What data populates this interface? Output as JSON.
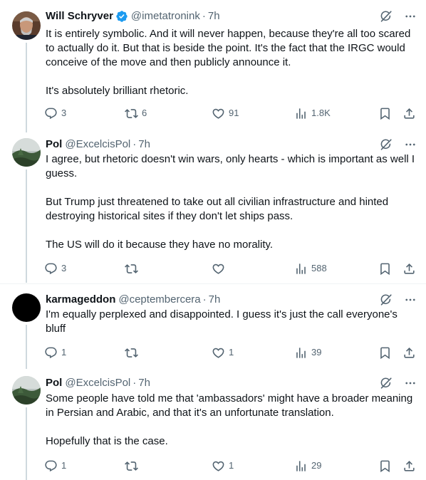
{
  "colors": {
    "text": "#0f1419",
    "muted": "#536471",
    "verified": "#1d9bf0",
    "thread_line": "#cfd9de",
    "divider": "#eff3f4"
  },
  "tweets": [
    {
      "name": "Will Schryver",
      "verified": true,
      "handle": "@imetatronink",
      "time": "7h",
      "paragraphs": [
        "It is entirely symbolic. And it will never happen, because they're all too scared to actually do it. But that is beside the point. It's the fact that the IRGC would conceive of the move and then publicly announce it.",
        "It's absolutely brilliant rhetoric."
      ],
      "replies": "3",
      "reposts": "6",
      "likes": "91",
      "views": "1.8K"
    },
    {
      "name": "Pol",
      "verified": false,
      "handle": "@ExcelcisPol",
      "time": "7h",
      "paragraphs": [
        "I agree, but rhetoric doesn't win wars, only hearts - which is important as well I guess.",
        "But Trump just threatened to take out all civilian infrastructure and hinted destroying historical sites if they don't let ships pass.",
        "The US will do it because they have no morality."
      ],
      "replies": "3",
      "reposts": "",
      "likes": "",
      "views": "588"
    },
    {
      "name": "karmageddon",
      "verified": false,
      "handle": "@ceptembercera",
      "time": "7h",
      "paragraphs": [
        "I'm equally perplexed and disappointed. I guess it's just the call everyone's bluff"
      ],
      "replies": "1",
      "reposts": "",
      "likes": "1",
      "views": "39"
    },
    {
      "name": "Pol",
      "verified": false,
      "handle": "@ExcelcisPol",
      "time": "7h",
      "paragraphs": [
        "Some people have told me that 'ambassadors' might have a broader meaning in Persian and Arabic, and that it's an unfortunate translation.",
        "Hopefully that is the case."
      ],
      "replies": "1",
      "reposts": "",
      "likes": "1",
      "views": "29"
    }
  ],
  "separator": "·",
  "icons": {
    "verified": "verified-badge-icon",
    "grok": "grok-icon",
    "more": "more-options-icon",
    "reply": "reply-icon",
    "repost": "repost-icon",
    "like": "like-icon",
    "views": "views-icon",
    "bookmark": "bookmark-icon",
    "share": "share-icon"
  }
}
